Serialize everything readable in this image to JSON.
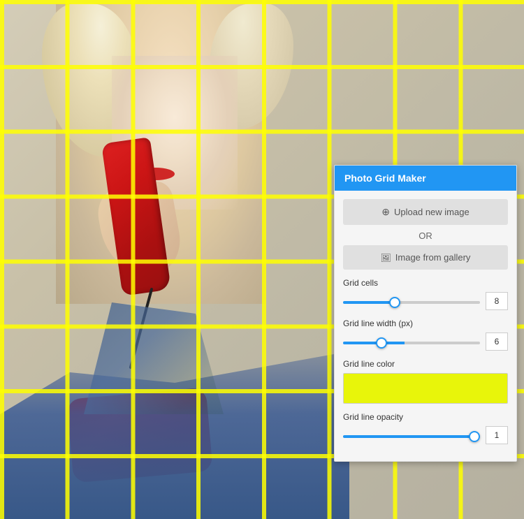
{
  "panel": {
    "title": "Photo Grid Maker",
    "upload_button": "Upload new image",
    "or_text": "OR",
    "gallery_button": "Image from gallery",
    "grid_cells_label": "Grid cells",
    "grid_cells_value": "8",
    "grid_cells_slider_value": 38,
    "grid_line_width_label": "Grid line width (px)",
    "grid_line_width_value": "6",
    "grid_line_width_slider_value": 45,
    "grid_line_color_label": "Grid line color",
    "grid_line_color_hex": "#e8f50a",
    "grid_line_opacity_label": "Grid line opacity",
    "grid_line_opacity_value": "1",
    "grid_line_opacity_slider_value": 95
  },
  "colors": {
    "header_bg": "#2196F3",
    "grid_color": "#e8f50a",
    "slider_active": "#2196F3"
  },
  "icons": {
    "upload": "⊕",
    "gallery": "📋"
  }
}
